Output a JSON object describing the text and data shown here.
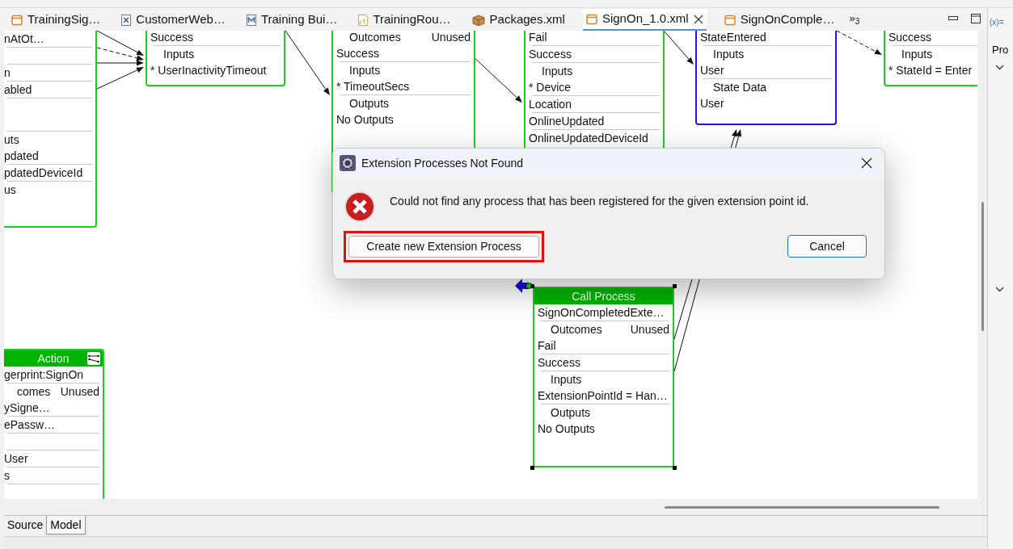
{
  "editor_tabs": [
    {
      "label": "TrainingSig…",
      "kind": "process",
      "selected": false,
      "closable": false
    },
    {
      "label": "CustomerWeb…",
      "kind": "xml",
      "selected": false,
      "closable": false
    },
    {
      "label": "Training Bui…",
      "kind": "model",
      "selected": false,
      "closable": false
    },
    {
      "label": "TrainingRou…",
      "kind": "script",
      "selected": false,
      "closable": false
    },
    {
      "label": "Packages.xml",
      "kind": "package",
      "selected": false,
      "closable": false
    },
    {
      "label": "SignOn_1.0.xml",
      "kind": "process",
      "selected": true,
      "closable": true
    },
    {
      "label": "SignOnComple…",
      "kind": "process",
      "selected": false,
      "closable": false
    }
  ],
  "tab_overflow": {
    "glyph": "»",
    "count": "3"
  },
  "side_panel": {
    "variables_label": "(x)=",
    "heading": "Pro"
  },
  "nodes": [
    {
      "color": "#22cc22",
      "rows": [
        {
          "kind": "divider"
        },
        {
          "kind": "item",
          "text": "nAtOt…"
        },
        {
          "kind": "divider"
        },
        {
          "kind": "blank"
        },
        {
          "kind": "divider"
        },
        {
          "kind": "item",
          "text": "n"
        },
        {
          "kind": "divider"
        },
        {
          "kind": "item",
          "text": "abled"
        },
        {
          "kind": "divider"
        },
        {
          "kind": "blank"
        },
        {
          "kind": "blank"
        },
        {
          "kind": "divider"
        },
        {
          "kind": "item",
          "text": "uts"
        },
        {
          "kind": "item",
          "text": "pdated"
        },
        {
          "kind": "divider"
        },
        {
          "kind": "item",
          "text": "pdatedDeviceId"
        },
        {
          "kind": "divider"
        },
        {
          "kind": "item",
          "text": "us"
        }
      ]
    },
    {
      "color": "#22cc22",
      "rows": [
        {
          "kind": "item",
          "text": "Success"
        },
        {
          "kind": "divider"
        },
        {
          "kind": "heading",
          "text": "Inputs"
        },
        {
          "kind": "item",
          "text": "* UserInactivityTimeout"
        }
      ]
    },
    {
      "color": "#22cc22",
      "rows": [
        {
          "kind": "pair",
          "text": "Outcomes",
          "aside": "Unused"
        },
        {
          "kind": "item",
          "text": "Success"
        },
        {
          "kind": "divider"
        },
        {
          "kind": "heading",
          "text": "Inputs"
        },
        {
          "kind": "item",
          "text": "* TimeoutSecs"
        },
        {
          "kind": "divider"
        },
        {
          "kind": "heading",
          "text": "Outputs"
        },
        {
          "kind": "item",
          "text": "No Outputs"
        }
      ]
    },
    {
      "color": "#22cc22",
      "rows": [
        {
          "kind": "item",
          "text": "Fail"
        },
        {
          "kind": "divider"
        },
        {
          "kind": "item",
          "text": "Success"
        },
        {
          "kind": "divider"
        },
        {
          "kind": "heading",
          "text": "Inputs"
        },
        {
          "kind": "item",
          "text": "* Device"
        },
        {
          "kind": "divider"
        },
        {
          "kind": "item",
          "text": "Location"
        },
        {
          "kind": "divider"
        },
        {
          "kind": "item",
          "text": "OnlineUpdated"
        },
        {
          "kind": "divider"
        },
        {
          "kind": "item",
          "text": "OnlineUpdatedDeviceId"
        }
      ]
    },
    {
      "color": "#1a1aee",
      "rows": [
        {
          "kind": "item",
          "text": "StateEntered"
        },
        {
          "kind": "divider"
        },
        {
          "kind": "heading",
          "text": "Inputs"
        },
        {
          "kind": "item",
          "text": "User"
        },
        {
          "kind": "divider"
        },
        {
          "kind": "heading",
          "text": "State Data"
        },
        {
          "kind": "item",
          "text": "User"
        }
      ]
    },
    {
      "color": "#22cc22",
      "rows": [
        {
          "kind": "item",
          "text": "Success"
        },
        {
          "kind": "divider"
        },
        {
          "kind": "heading",
          "text": "Inputs"
        },
        {
          "kind": "item",
          "text": "* StateId = Enter"
        }
      ]
    },
    {
      "color": "#22cc22",
      "header": "Action",
      "header_icon": true,
      "rows": [
        {
          "kind": "item",
          "text": "gerprint:SignOn"
        },
        {
          "kind": "divider"
        },
        {
          "kind": "pair",
          "text": "comes",
          "aside": "Unused"
        },
        {
          "kind": "item",
          "text": "ySigne…"
        },
        {
          "kind": "divider"
        },
        {
          "kind": "item",
          "text": "ePassw…"
        },
        {
          "kind": "divider"
        },
        {
          "kind": "blank"
        },
        {
          "kind": "divider"
        },
        {
          "kind": "item",
          "text": "User"
        },
        {
          "kind": "divider"
        },
        {
          "kind": "item",
          "text": "s"
        },
        {
          "kind": "divider"
        }
      ]
    },
    {
      "color": "#22cc22",
      "header": "Call Process",
      "header_icon": false,
      "selected": true,
      "rows": [
        {
          "kind": "item",
          "text": "SignOnCompletedExte…"
        },
        {
          "kind": "divider"
        },
        {
          "kind": "pair",
          "text": "Outcomes",
          "aside": "Unused"
        },
        {
          "kind": "item",
          "text": "Fail"
        },
        {
          "kind": "divider"
        },
        {
          "kind": "item",
          "text": "Success"
        },
        {
          "kind": "divider"
        },
        {
          "kind": "heading",
          "text": "Inputs"
        },
        {
          "kind": "item",
          "text": "ExtensionPointId = Han…"
        },
        {
          "kind": "divider"
        },
        {
          "kind": "heading",
          "text": "Outputs"
        },
        {
          "kind": "item",
          "text": "No Outputs"
        }
      ]
    }
  ],
  "bottom_tabs": [
    {
      "label": "Source",
      "selected": false
    },
    {
      "label": "Model",
      "selected": true
    }
  ],
  "dialog": {
    "title": "Extension Processes Not Found",
    "message": "Could not find any process that has been registered for the given extension point id.",
    "buttons": [
      {
        "label": "Create new Extension Process",
        "kind": "default",
        "highlighted": true
      },
      {
        "label": "Cancel",
        "kind": "primary",
        "highlighted": false
      }
    ]
  }
}
